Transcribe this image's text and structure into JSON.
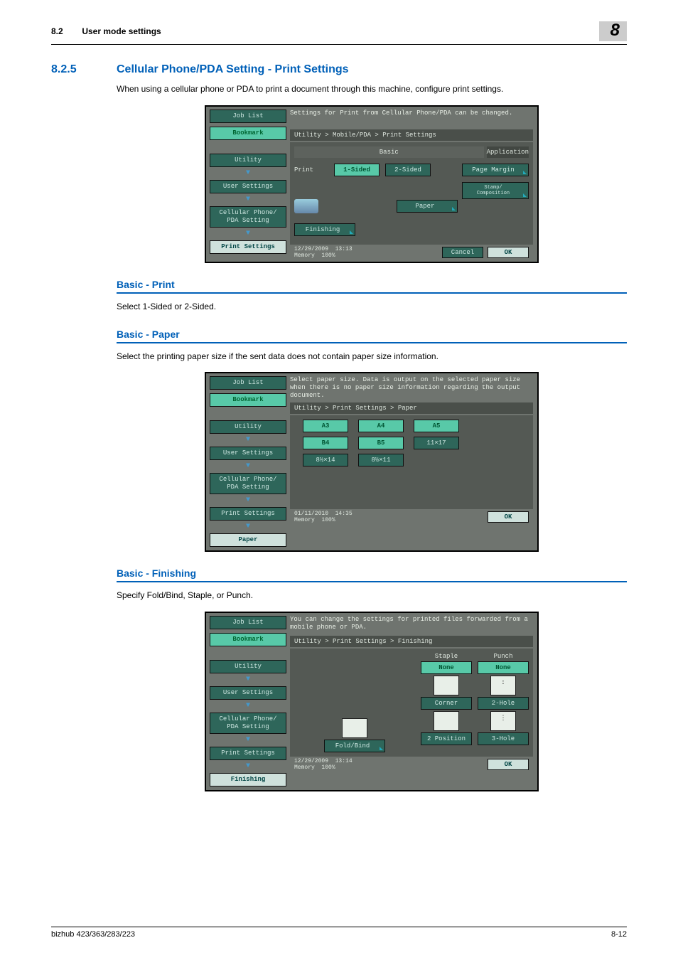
{
  "header": {
    "section_num": "8.2",
    "section_title": "User mode settings",
    "chapter_badge": "8"
  },
  "section": {
    "num": "8.2.5",
    "title": "Cellular Phone/PDA Setting - Print Settings",
    "intro": "When using a cellular phone or PDA to print a document through this machine, configure print settings."
  },
  "sub1": {
    "heading": "Basic - Print",
    "text": "Select 1-Sided or 2-Sided."
  },
  "sub2": {
    "heading": "Basic - Paper",
    "text": "Select the printing paper size if the sent data does not contain paper size information."
  },
  "sub3": {
    "heading": "Basic - Finishing",
    "text": "Specify Fold/Bind, Staple, or Punch."
  },
  "panel_common": {
    "job_list": "Job List",
    "bookmark": "Bookmark",
    "utility": "Utility",
    "user_settings": "User Settings",
    "cell_pda": "Cellular Phone/\nPDA Setting",
    "print_settings": "Print Settings",
    "paper": "Paper",
    "finishing": "Finishing",
    "cancel": "Cancel",
    "ok": "OK",
    "memory": "Memory",
    "mem_pct": "100%"
  },
  "panel1": {
    "msg": "Settings for Print from Cellular Phone/PDA can be changed.",
    "crumb": "Utility > Mobile/PDA > Print Settings",
    "tab_basic": "Basic",
    "tab_app": "Application",
    "print_label": "Print",
    "one_sided": "1-Sided",
    "two_sided": "2-Sided",
    "page_margin": "Page Margin",
    "stamp": "Stamp/\nComposition",
    "paper_btn": "Paper",
    "finishing_btn": "Finishing",
    "date": "12/29/2009",
    "time": "13:13"
  },
  "panel2": {
    "msg": "Select paper size. Data is output on the selected paper size when there is no paper size information regarding the output document.",
    "crumb": "Utility > Print Settings > Paper",
    "sizes": {
      "a3": "A3",
      "a4": "A4",
      "a5": "A5",
      "b4": "B4",
      "b5": "B5",
      "s11x17": "11×17",
      "s8x14": "8½×14",
      "s8x11": "8½×11"
    },
    "date": "01/11/2010",
    "time": "14:35"
  },
  "panel3": {
    "msg": "You can change the settings for printed files forwarded from a mobile phone or PDA.",
    "crumb": "Utility > Print Settings > Finishing",
    "fold_bind": "Fold/Bind",
    "staple_head": "Staple",
    "punch_head": "Punch",
    "none": "None",
    "corner": "Corner",
    "two_pos": "2 Position",
    "two_hole": "2-Hole",
    "three_hole": "3-Hole",
    "date": "12/29/2009",
    "time": "13:14"
  },
  "footer": {
    "model": "bizhub 423/363/283/223",
    "page": "8-12"
  }
}
